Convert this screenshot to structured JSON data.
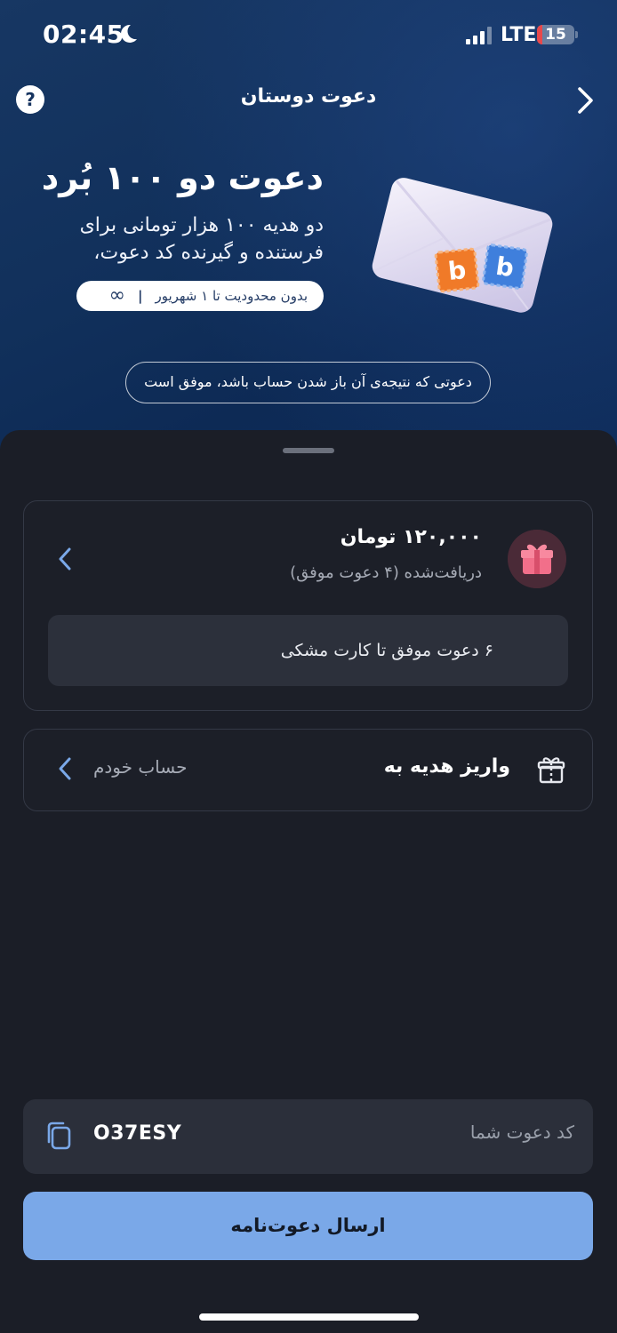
{
  "status_bar": {
    "time": "02:45",
    "network": "LTE",
    "battery": "15",
    "battery_level": 0.15
  },
  "header": {
    "title": "دعوت دوستان",
    "help_label": "?"
  },
  "hero": {
    "title": "دعوت دو ۱۰۰ بُرد",
    "subtitle": "دو هدیه ۱۰۰ هزار تومانی برای فرستنده و گیرنده کد دعوت،",
    "pill_text": "بدون محدودیت تا ۱ شهریور",
    "pill_sep": "|",
    "pill_icon": "∞",
    "note": "دعوتی که نتیجه‌ی آن باز شدن حساب باشد، موفق است"
  },
  "rewards": {
    "amount": "۱۲۰,۰۰۰ تومان",
    "received": "دریافت‌شده (۴ دعوت موفق)",
    "progress_text": "۶ دعوت موفق تا کارت مشکی"
  },
  "deposit": {
    "label": "واریز هدیه به",
    "value": "حساب خودم"
  },
  "invite_code": {
    "label": "کد دعوت شما",
    "value": "O37ESY"
  },
  "send_button": {
    "label": "ارسال دعوت‌نامه"
  },
  "colors": {
    "accent": "#7aa8e8",
    "background": "#1b1e27",
    "hero": "#11305b",
    "stamp_orange": "#f07a28",
    "stamp_blue": "#3f7fdc"
  }
}
